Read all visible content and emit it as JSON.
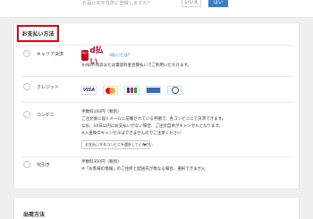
{
  "top_bar": {
    "question": "お届け先を住所に登録しますか？",
    "no_label": "いいえ",
    "yes_label": "はい"
  },
  "payment_section": {
    "title": "お支払い方法",
    "options": [
      {
        "label": "キャリア決済",
        "logo_badge": "d払い",
        "logo_text": "d払い",
        "link": "d払いとは？",
        "note": "※d払い残高または電話料金合算払いでご利用いただけます。"
      },
      {
        "label": "クレジット",
        "brands": [
          "VISA",
          "Mastercard",
          "JCB",
          "AMERICAN EXPRESS",
          "Diners Club"
        ]
      },
      {
        "label": "コンビニ",
        "lines": [
          "手数料100円（税別）",
          "ご注文後に届くメールに記載されている手順で、各コンビニにて決済できます。",
          "なお、10日以内にお支払いがない場合、ご注文自体がキャンセルとなります。",
          "※入金後のキャンセルはできませんのでご注意ください"
        ],
        "select_value": "お支払いするコンビニを選択してください"
      },
      {
        "label": "代引き",
        "lines": [
          "手数料350円（税別）",
          "※「お客様の情報」のご住所と配送先が異なる場合、選択できません"
        ]
      }
    ]
  },
  "shipping_section": {
    "title": "出荷方法"
  },
  "colors": {
    "highlight": "#e60012",
    "accent": "#3a7ec5",
    "dpay_red": "#c7001f"
  }
}
